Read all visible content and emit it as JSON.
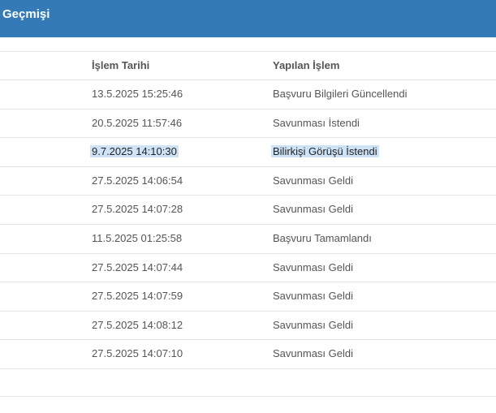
{
  "header": {
    "title": "Geçmişi"
  },
  "table": {
    "columns": [
      "İşlem Tarihi",
      "Yapılan İşlem"
    ],
    "rows": [
      {
        "date": "13.5.2025 15:25:46",
        "action": "Başvuru Bilgileri Güncellendi",
        "selected": false
      },
      {
        "date": "20.5.2025 11:57:46",
        "action": "Savunması İstendi",
        "selected": false
      },
      {
        "date": "9.7.2025 14:10:30",
        "action": "Bilirkişi Görüşü İstendi",
        "selected": true
      },
      {
        "date": "27.5.2025 14:06:54",
        "action": "Savunması Geldi",
        "selected": false
      },
      {
        "date": "27.5.2025 14:07:28",
        "action": "Savunması Geldi",
        "selected": false
      },
      {
        "date": "11.5.2025 01:25:58",
        "action": "Başvuru Tamamlandı",
        "selected": false
      },
      {
        "date": "27.5.2025 14:07:44",
        "action": "Savunması Geldi",
        "selected": false
      },
      {
        "date": "27.5.2025 14:07:59",
        "action": "Savunması Geldi",
        "selected": false
      },
      {
        "date": "27.5.2025 14:08:12",
        "action": "Savunması Geldi",
        "selected": false
      },
      {
        "date": "27.5.2025 14:07:10",
        "action": "Savunması Geldi",
        "selected": false
      }
    ]
  },
  "colors": {
    "header_bg": "#337ab7",
    "selection": "#cfe3f7"
  }
}
